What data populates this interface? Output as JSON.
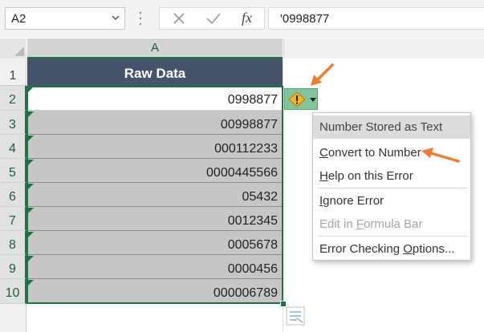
{
  "formula_bar": {
    "name_box": "A2",
    "fx_label": "fx",
    "formula": "'0998877"
  },
  "column_headers": [
    "A"
  ],
  "rows": [
    {
      "num": "1",
      "value": "Raw Data"
    },
    {
      "num": "2",
      "value": "0998877"
    },
    {
      "num": "3",
      "value": "00998877"
    },
    {
      "num": "4",
      "value": "000112233"
    },
    {
      "num": "5",
      "value": "0000445566"
    },
    {
      "num": "6",
      "value": "05432"
    },
    {
      "num": "7",
      "value": "0012345"
    },
    {
      "num": "8",
      "value": "0005678"
    },
    {
      "num": "9",
      "value": "0000456"
    },
    {
      "num": "10",
      "value": "000006789"
    }
  ],
  "error_menu": {
    "header": "Number Stored as Text",
    "items": [
      {
        "pre": "",
        "key": "C",
        "post": "onvert to Number"
      },
      {
        "pre": "",
        "key": "H",
        "post": "elp on this Error"
      },
      {
        "pre": "",
        "key": "I",
        "post": "gnore Error"
      },
      {
        "pre": "Edit in ",
        "key": "F",
        "post": "ormula Bar"
      },
      {
        "pre": "Error Checking ",
        "key": "O",
        "post": "ptions..."
      }
    ]
  },
  "colors": {
    "header_fill": "#44546a",
    "selected_fill": "#c6c6c6",
    "accent_green": "#217346",
    "annotation_arrow": "#ed7d31"
  },
  "icons": {
    "error_indicator": "warning-diamond-icon",
    "quick_analysis": "quick-analysis-icon"
  }
}
